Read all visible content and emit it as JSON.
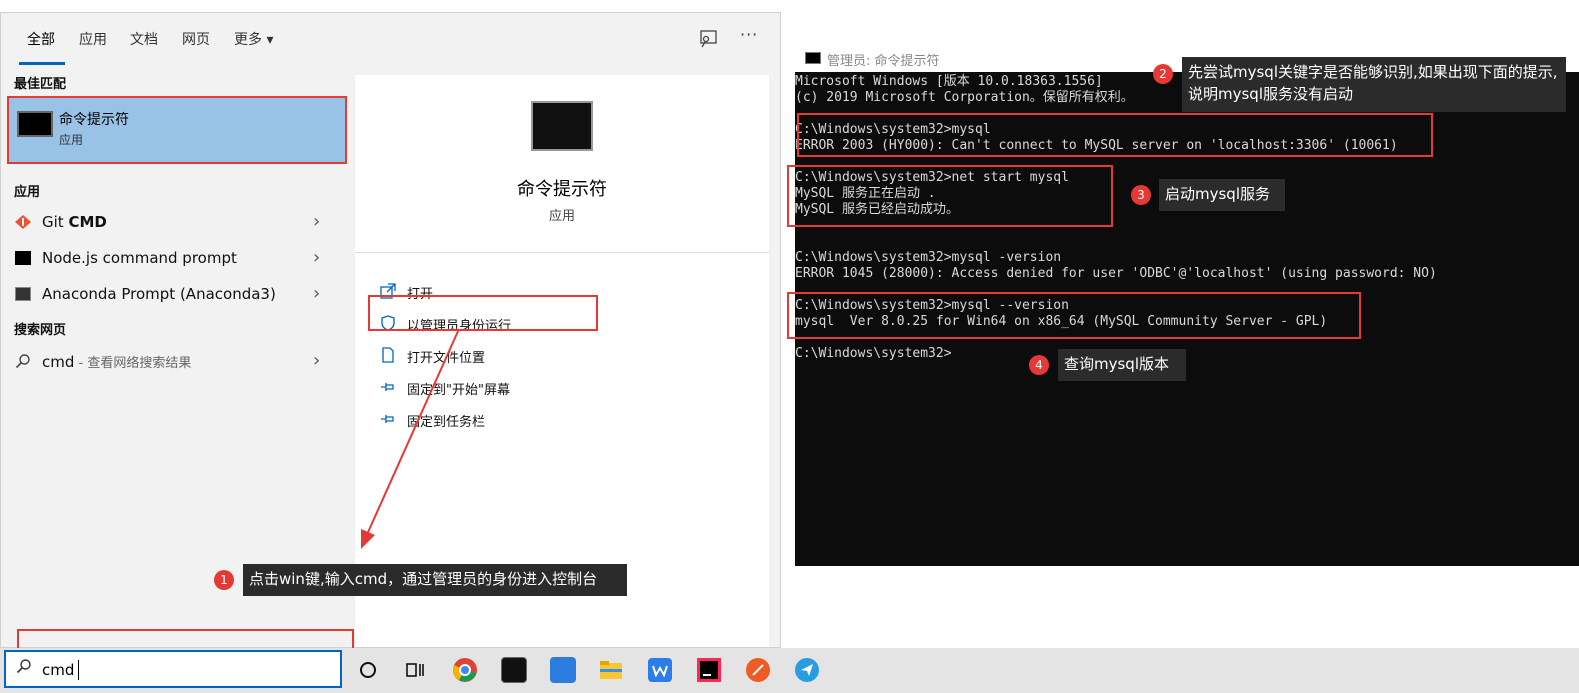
{
  "start_menu": {
    "tabs": [
      {
        "label": "全部"
      },
      {
        "label": "应用"
      },
      {
        "label": "文档"
      },
      {
        "label": "网页"
      },
      {
        "label": "更多 ▾"
      }
    ],
    "more_dots": "···",
    "best_match": {
      "section": "最佳匹配",
      "title": "命令提示符",
      "subtitle": "应用"
    },
    "apps_section": "应用",
    "apps": [
      {
        "label_prefix": "Git ",
        "label_bold": "CMD"
      },
      {
        "label": "Node.js command prompt"
      },
      {
        "label": "Anaconda Prompt (Anaconda3)"
      }
    ],
    "web_section": "搜索网页",
    "web_result": {
      "label": "cmd",
      "suffix": " - 查看网络搜索结果"
    },
    "chevron": "›",
    "preview": {
      "title": "命令提示符",
      "subtitle": "应用",
      "actions": [
        {
          "label": "打开",
          "icon": "open-icon"
        },
        {
          "label": "以管理员身份运行",
          "icon": "shield-icon"
        },
        {
          "label": "打开文件位置",
          "icon": "file-location-icon"
        },
        {
          "label": "固定到\"开始\"屏幕",
          "icon": "pin-icon"
        },
        {
          "label": "固定到任务栏",
          "icon": "pin-icon"
        }
      ]
    }
  },
  "cmd": {
    "title": "管理员: 命令提示符",
    "lines": [
      "Microsoft Windows [版本 10.0.18363.1556]",
      "(c) 2019 Microsoft Corporation。保留所有权利。",
      "",
      "C:\\Windows\\system32>mysql",
      "ERROR 2003 (HY000): Can't connect to MySQL server on 'localhost:3306' (10061)",
      "",
      "C:\\Windows\\system32>net start mysql",
      "MySQL 服务正在启动 .",
      "MySQL 服务已经启动成功。",
      "",
      "",
      "C:\\Windows\\system32>mysql -version",
      "ERROR 1045 (28000): Access denied for user 'ODBC'@'localhost' (using password: NO)",
      "",
      "C:\\Windows\\system32>mysql --version",
      "mysql  Ver 8.0.25 for Win64 on x86_64 (MySQL Community Server - GPL)",
      "",
      "C:\\Windows\\system32>"
    ]
  },
  "annotations": [
    {
      "number": "1",
      "text": "点击win键,输入cmd，通过管理员的身份进入控制台"
    },
    {
      "number": "2",
      "text": "先尝试mysql关键字是否能够识别,如果出现下面的提示,说明mysql服务没有启动"
    },
    {
      "number": "3",
      "text": "启动mysql服务"
    },
    {
      "number": "4",
      "text": "查询mysql版本"
    }
  ],
  "taskbar": {
    "search_value": "cmd",
    "search_icon": "search-icon",
    "icons": [
      "cortana-icon",
      "task-view-icon",
      "chrome-icon",
      "terminal-icon",
      "notes-icon",
      "file-explorer-icon",
      "wps-icon",
      "intellij-icon",
      "postman-icon",
      "send-icon"
    ]
  },
  "colors": {
    "accent": "#0067c0",
    "highlight": "#e53935",
    "selection": "#99c3e6"
  }
}
